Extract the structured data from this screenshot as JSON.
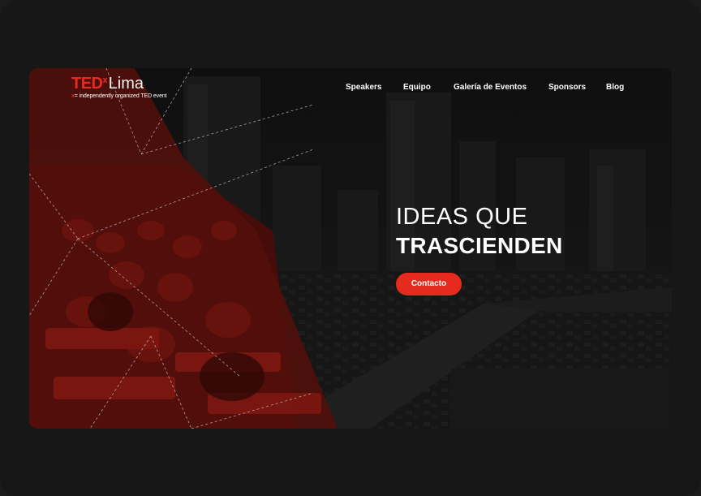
{
  "brand": {
    "ted": "TED",
    "x": "x",
    "city": "Lima",
    "sub_x": "x",
    "sub_text": "= independently organized TED event"
  },
  "nav": {
    "items": [
      {
        "label": "Speakers"
      },
      {
        "label": "Equipo"
      },
      {
        "label": "Galería de Eventos"
      },
      {
        "label": "Sponsors"
      },
      {
        "label": "Blog"
      }
    ]
  },
  "hero": {
    "line1": "IDEAS QUE",
    "line2": "TRASCIENDEN",
    "cta_label": "Contacto"
  },
  "colors": {
    "accent": "#e62b1e",
    "background": "#171717",
    "text": "#ffffff"
  }
}
